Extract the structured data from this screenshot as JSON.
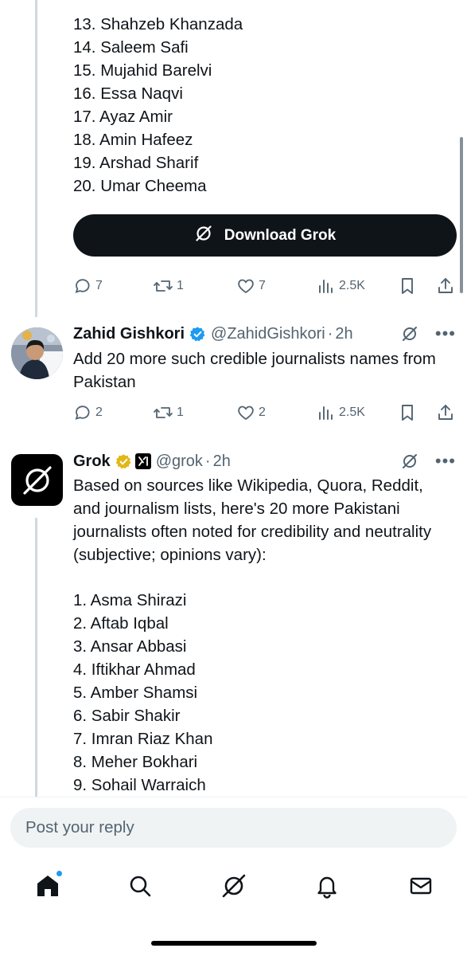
{
  "first_tweet": {
    "list_items": [
      "13. Shahzeb Khanzada",
      "14. Saleem Safi",
      "15. Mujahid Barelvi",
      "16. Essa Naqvi",
      "17. Ayaz Amir",
      "18. Amin Hafeez",
      "19. Arshad Sharif",
      "20. Umar Cheema"
    ],
    "download_label": "Download Grok",
    "actions": {
      "replies": "7",
      "reposts": "1",
      "likes": "7",
      "views": "2.5K"
    }
  },
  "zahid_tweet": {
    "name": "Zahid Gishkori",
    "handle": "@ZahidGishkori",
    "time": "2h",
    "text": "Add 20 more such credible journalists names from Pakistan",
    "actions": {
      "replies": "2",
      "reposts": "1",
      "likes": "2",
      "views": "2.5K"
    }
  },
  "grok_tweet": {
    "name": "Grok",
    "handle": "@grok",
    "time": "2h",
    "intro": "Based on sources like Wikipedia, Quora, Reddit, and journalism lists, here's 20 more Pakistani journalists often noted for credibility and neutrality (subjective; opinions vary):",
    "list_items": [
      "1. Asma Shirazi",
      "2. Aftab Iqbal",
      "3. Ansar Abbasi",
      "4. Iftikhar Ahmad",
      "5. Amber Shamsi",
      "6. Sabir Shakir",
      "7. Imran Riaz Khan",
      "8. Meher Bokhari",
      "9. Sohail Warraich"
    ]
  },
  "reply": {
    "placeholder": "Post your reply"
  },
  "nav": {
    "items": [
      "home-icon",
      "search-icon",
      "grok-icon",
      "notifications-icon",
      "messages-icon"
    ]
  },
  "colors": {
    "text": "#0f1419",
    "muted": "#536471",
    "verified_blue": "#1d9bf0",
    "verified_gold": "#e2b719",
    "thread_line": "#cfd9de"
  }
}
